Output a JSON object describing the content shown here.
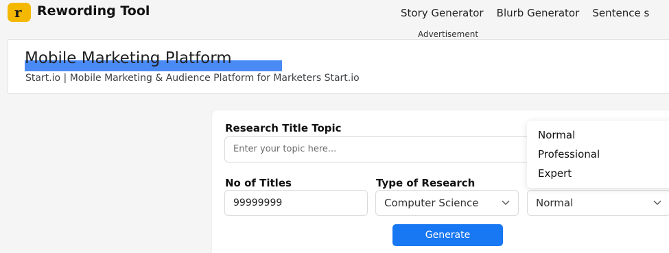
{
  "header": {
    "logo_letter": "r",
    "brand": "Rewording Tool",
    "nav": [
      "Story Generator",
      "Blurb Generator",
      "Sentence s"
    ]
  },
  "ad": {
    "label": "Advertisement",
    "title": "Mobile Marketing Platform",
    "subtitle": "Start.io | Mobile Marketing & Audience Platform for Marketers Start.io"
  },
  "form": {
    "topic_label": "Research Title Topic",
    "topic_placeholder": "Enter your topic here...",
    "titles_label": "No of Titles",
    "titles_value": "99999999",
    "type_label": "Type of Research",
    "type_value": "Computer Science",
    "level_value": "Normal",
    "level_options": [
      "Normal",
      "Professional",
      "Expert"
    ],
    "generate_label": "Generate"
  }
}
